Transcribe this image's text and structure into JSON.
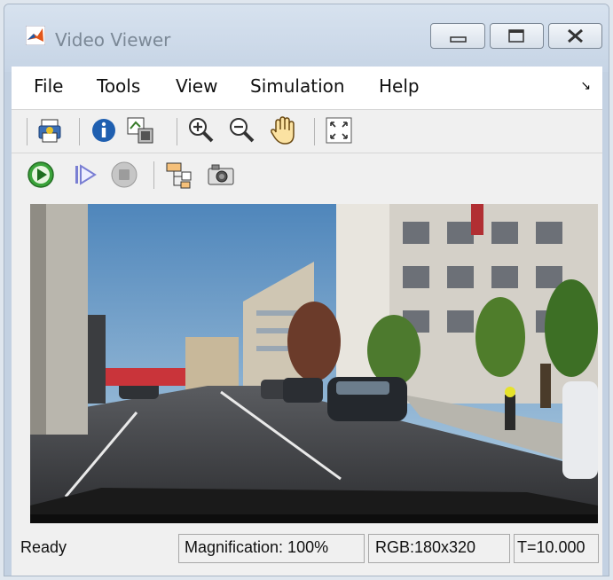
{
  "window": {
    "title": "Video Viewer"
  },
  "menu": {
    "items": [
      "File",
      "Tools",
      "View",
      "Simulation",
      "Help"
    ]
  },
  "toolbar1": {
    "icons": [
      "print-icon",
      "info-icon",
      "maintain-fit-icon",
      "zoom-in-icon",
      "zoom-out-icon",
      "pan-hand-icon",
      "fit-to-view-icon"
    ]
  },
  "toolbar2": {
    "icons": [
      "run-icon",
      "step-forward-icon",
      "stop-icon",
      "highlight-block-icon",
      "snapshot-icon"
    ]
  },
  "colors": {
    "accent_run": "#3aa33a",
    "sky": "#7aa8c8",
    "road": "#3a3a3a"
  },
  "status": {
    "state": "Ready",
    "magnification": "Magnification: 100%",
    "rgb": "RGB:180x320",
    "time": "T=10.000"
  }
}
